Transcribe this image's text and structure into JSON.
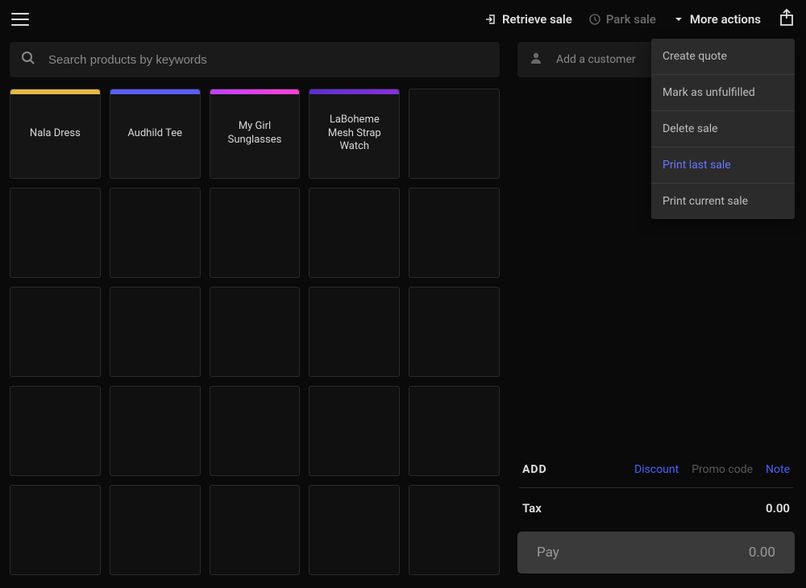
{
  "topbar": {
    "retrieve_label": "Retrieve sale",
    "park_label": "Park sale",
    "more_label": "More actions"
  },
  "search": {
    "placeholder": "Search products by keywords"
  },
  "products": [
    {
      "name": "Nala Dress",
      "stripe": "#e6b84a"
    },
    {
      "name": "Audhild Tee",
      "stripe": "#5a5cff"
    },
    {
      "name": "My Girl Sunglasses",
      "stripe": "linear-gradient(90deg,#c23fff,#ff3fd3)"
    },
    {
      "name": "LaBoheme Mesh Strap Watch",
      "stripe": "linear-gradient(90deg,#5a2fd0,#8a2fe0)"
    }
  ],
  "grid": {
    "cols": 5,
    "rows": 5
  },
  "customer": {
    "add_label": "Add a customer"
  },
  "more_menu": {
    "items": [
      {
        "label": "Create quote",
        "highlight": false
      },
      {
        "label": "Mark as unfulfilled",
        "highlight": false
      },
      {
        "label": "Delete sale",
        "highlight": false
      },
      {
        "label": "Print last sale",
        "highlight": true
      },
      {
        "label": "Print current sale",
        "highlight": false
      }
    ]
  },
  "add_section": {
    "title": "ADD",
    "discount": "Discount",
    "promo": "Promo code",
    "note": "Note"
  },
  "totals": {
    "tax_label": "Tax",
    "tax_value": "0.00",
    "pay_label": "Pay",
    "pay_value": "0.00"
  }
}
